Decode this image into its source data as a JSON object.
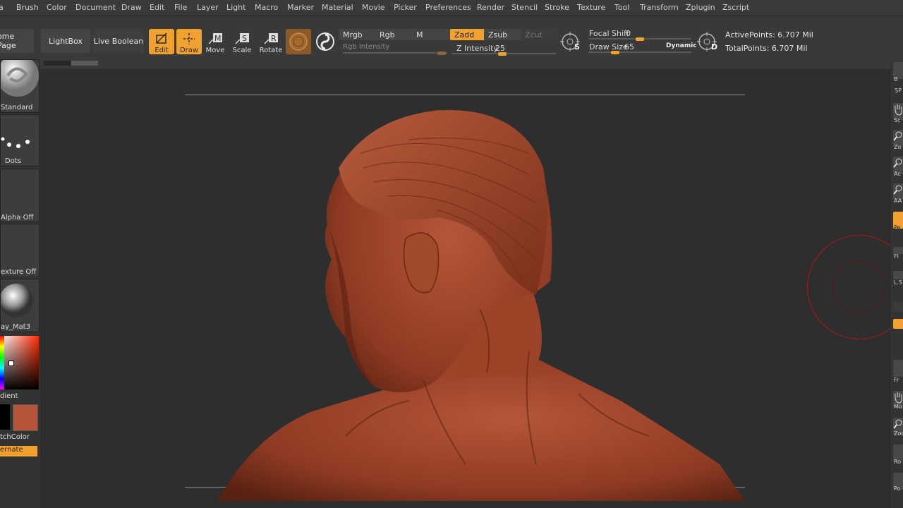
{
  "menu": [
    "a",
    "Brush",
    "Color",
    "Document",
    "Draw",
    "Edit",
    "File",
    "Layer",
    "Light",
    "Macro",
    "Marker",
    "Material",
    "Movie",
    "Picker",
    "Preferences",
    "Render",
    "Stencil",
    "Stroke",
    "Texture",
    "Tool",
    "Transform",
    "Zplugin",
    "Zscript"
  ],
  "toolbar": {
    "home_page": "ome Page",
    "lightbox": "LightBox",
    "live_boolean": "Live Boolean",
    "edit": "Edit",
    "draw": "Draw",
    "move": "Move",
    "scale": "Scale",
    "rotate": "Rotate",
    "mrgb": "Mrgb",
    "rgb": "Rgb",
    "m": "M",
    "rgb_intensity": "Rgb Intensity",
    "zadd": "Zadd",
    "zsub": "Zsub",
    "zcut": "Zcut",
    "z_intensity_label": "Z Intensity",
    "z_intensity_value": "25",
    "focal_shift_label": "Focal Shift",
    "focal_shift_value": "0",
    "draw_size_label": "Draw Size",
    "draw_size_value": "65",
    "dynamic": "Dynamic",
    "active_points": "ActivePoints: 6.707 Mil",
    "total_points": "TotalPoints: 6.707 Mil",
    "s_label": "S",
    "d_label": "D"
  },
  "left": {
    "brush": "Standard",
    "stroke": "Dots",
    "alpha": "Alpha Off",
    "texture": "exture Off",
    "material": "ay_Mat3",
    "gradient": "dient",
    "switch_color": "tchColor",
    "alternate": "ernate"
  },
  "right": [
    "B",
    "SP",
    "Sc",
    "Zo",
    "Ac",
    "AA",
    "Pe",
    "Fl",
    "L.S",
    "Fr",
    "Mo",
    "Zoo",
    "Ro",
    "Po"
  ],
  "colors": {
    "accent": "#f0a12e",
    "clay": "#a84a30",
    "brush_ring": "#b01818",
    "secondary_swatch": "#b8543a"
  }
}
